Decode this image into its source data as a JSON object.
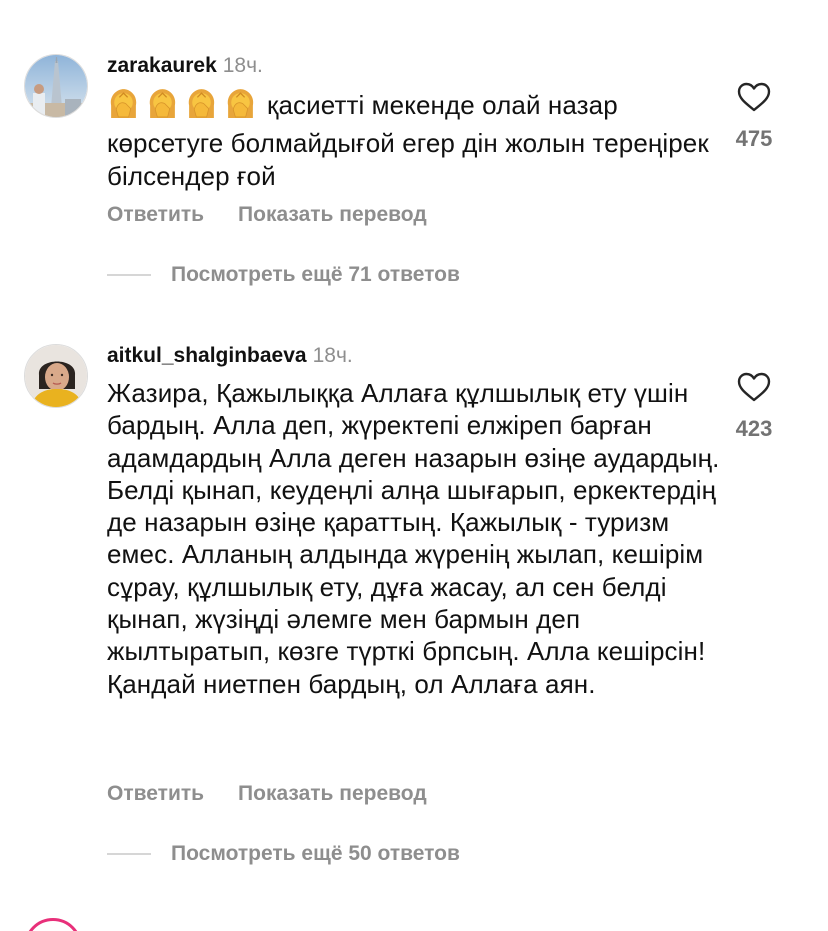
{
  "comments": [
    {
      "username": "zarakaurek",
      "time": "18ч.",
      "emoji_count": 4,
      "emoji_icon": "woman-facepalming-icon",
      "text": "қасиетті мекенде олай назар көрсетуге болмайдығой егер дін жолын тереңірек білсендер ғой",
      "likes": "475",
      "reply_label": "Ответить",
      "translate_label": "Показать перевод",
      "view_replies_label": "Посмотреть ещё 71 ответов"
    },
    {
      "username": "aitkul_shalginbaeva",
      "time": "18ч.",
      "text": "Жазира, Қажылыққа Аллаға құлшылық ету үшін бардың. Алла деп, жүректепі елжіреп барған адамдардың Алла деген назарын өзіңе аудардың. Белді қынап, кеудеңлі алңа шығарып, еркектердің де назарын өзіңе қараттың. Қажылық - туризм емес. Алланың алдында жүренің жылап, кешірім сұрау, құлшылық ету, дұға жасау, ал сен  белді қынап, жүзіңді әлемге мен бармын деп жылтыратып, көзге түрткі брпсың. Алла кешірсін! Қандай ниетпен бардың, ол Аллаға аян.",
      "likes": "423",
      "reply_label": "Ответить",
      "translate_label": "Показать перевод",
      "view_replies_label": "Посмотреть ещё 50 ответов"
    }
  ],
  "colors": {
    "text": "#111111",
    "secondary": "#8e8e8e",
    "story_ring": "#e8307a"
  }
}
